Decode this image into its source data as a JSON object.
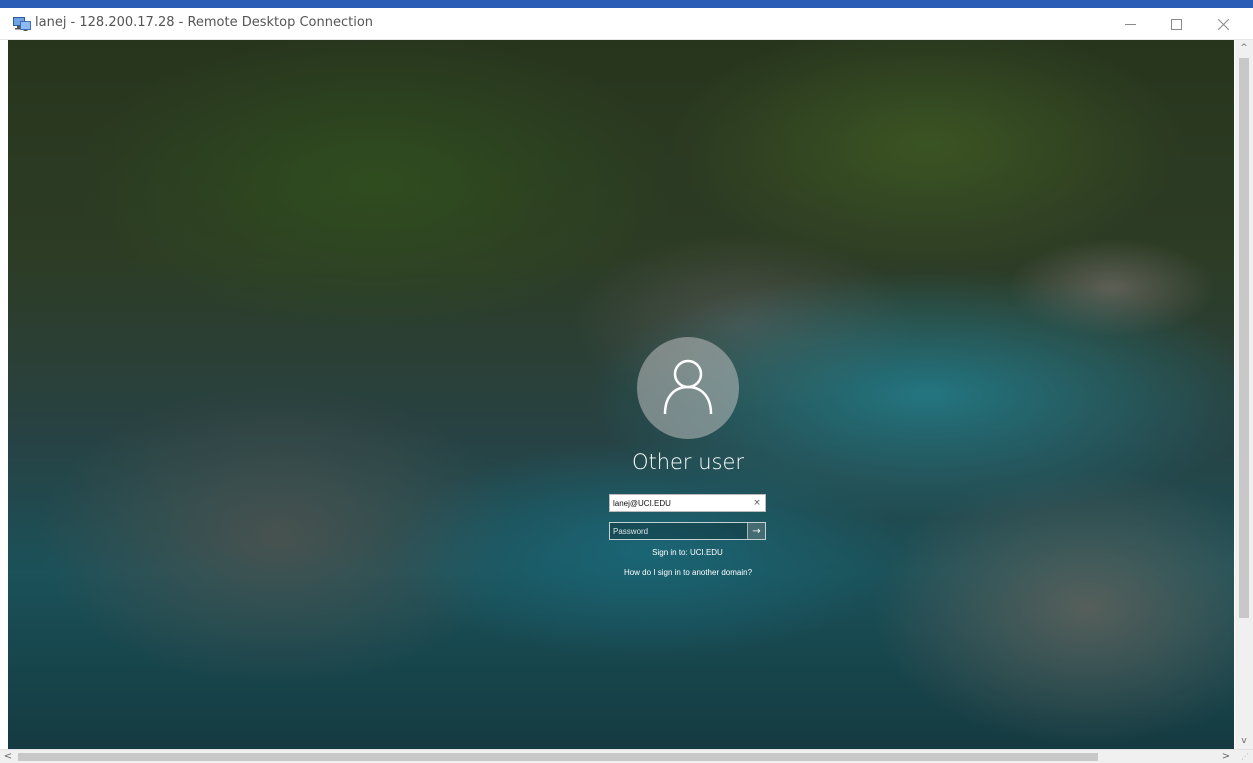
{
  "window": {
    "title": "lanej - 128.200.17.28 - Remote Desktop Connection",
    "icon": "remote-desktop-icon",
    "accent": "#2a5db5"
  },
  "controls": {
    "minimize_icon": "minimize-icon",
    "maximize_icon": "maximize-icon",
    "close_icon": "close-icon"
  },
  "login": {
    "avatar_icon": "user-icon",
    "user_label": "Other user",
    "username_value": "lanej@UCI.EDU",
    "clear_glyph": "×",
    "password_placeholder": "Password",
    "submit_glyph": "→",
    "sign_in_to": "Sign in to: UCI.EDU",
    "domain_help": "How do I sign in to another domain?"
  },
  "scrollbars": {
    "up_glyph": "^",
    "down_glyph": "v",
    "left_glyph": "<",
    "right_glyph": ">"
  }
}
